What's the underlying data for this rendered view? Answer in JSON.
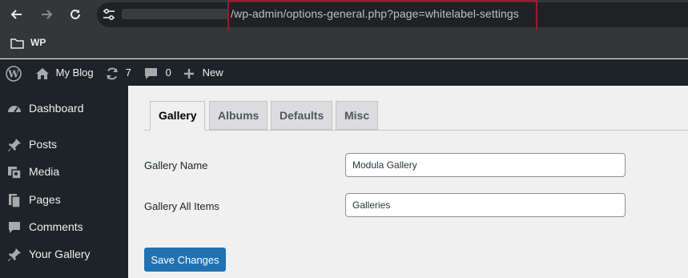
{
  "browser": {
    "back_icon": "arrow-left-icon",
    "forward_icon": "arrow-right-icon",
    "reload_icon": "reload-icon",
    "site_info_icon": "tune-icon",
    "url": "/wp-admin/options-general.php?page=whitelabel-settings",
    "highlight_color": "#9b1c2e"
  },
  "bookmarks": {
    "items": [
      {
        "label": "WP",
        "icon": "folder-icon"
      }
    ]
  },
  "adminbar": {
    "wp_logo_icon": "wordpress-logo-icon",
    "site_name": "My Blog",
    "updates_count": "7",
    "comments_count": "0",
    "new_label": "New"
  },
  "sidebar": {
    "items": [
      {
        "label": "Dashboard",
        "icon": "dashboard-icon"
      },
      {
        "label": "Posts",
        "icon": "pin-icon"
      },
      {
        "label": "Media",
        "icon": "media-icon"
      },
      {
        "label": "Pages",
        "icon": "pages-icon"
      },
      {
        "label": "Comments",
        "icon": "comment-icon"
      },
      {
        "label": "Your Gallery",
        "icon": "pin-icon"
      }
    ]
  },
  "tabs": [
    {
      "label": "Gallery",
      "active": true
    },
    {
      "label": "Albums",
      "active": false
    },
    {
      "label": "Defaults",
      "active": false
    },
    {
      "label": "Misc",
      "active": false
    }
  ],
  "form": {
    "fields": [
      {
        "label": "Gallery Name",
        "value": "Modula Gallery"
      },
      {
        "label": "Gallery All Items",
        "value": "Galleries"
      }
    ],
    "save_label": "Save Changes"
  },
  "colors": {
    "accent": "#2271b1",
    "admin_bar": "#1d2327",
    "content_bg": "#f0f0f1"
  }
}
